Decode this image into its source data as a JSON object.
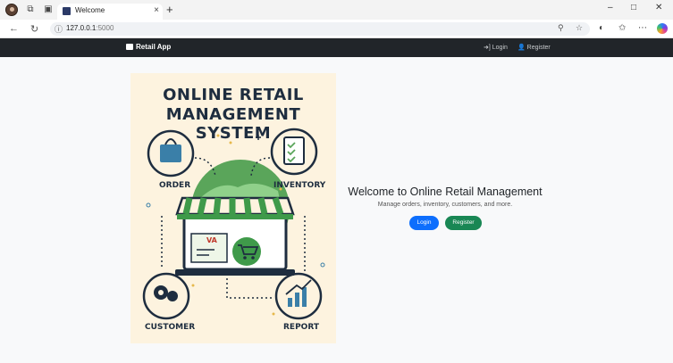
{
  "browser": {
    "tab_title": "Welcome",
    "tab_close": "×",
    "new_tab": "+",
    "url_host": "127.0.0.1",
    "url_port": ":5000",
    "win_minimize": "–",
    "win_maximize": "□",
    "win_close": "✕",
    "more_label": "⋯"
  },
  "navbar": {
    "brand": "Retail App",
    "login_label": "Login",
    "register_label": "Register"
  },
  "poster": {
    "title_line1": "ONLINE RETAIL",
    "title_line2": "MANAGEMENT SYSTEM",
    "order_label": "ORDER",
    "inventory_label": "INVENTORY",
    "customer_label": "CUSTOMER",
    "report_label": "REPORT",
    "screen_logo": "VA"
  },
  "hero": {
    "heading": "Welcome to Online Retail Management",
    "subtitle": "Manage orders, inventory, customers, and more.",
    "login_button": "Login",
    "register_button": "Register"
  },
  "colors": {
    "navbar_bg": "#212529",
    "login_button": "#0d6efd",
    "register_button": "#198754",
    "poster_bg": "#fdf3df"
  }
}
